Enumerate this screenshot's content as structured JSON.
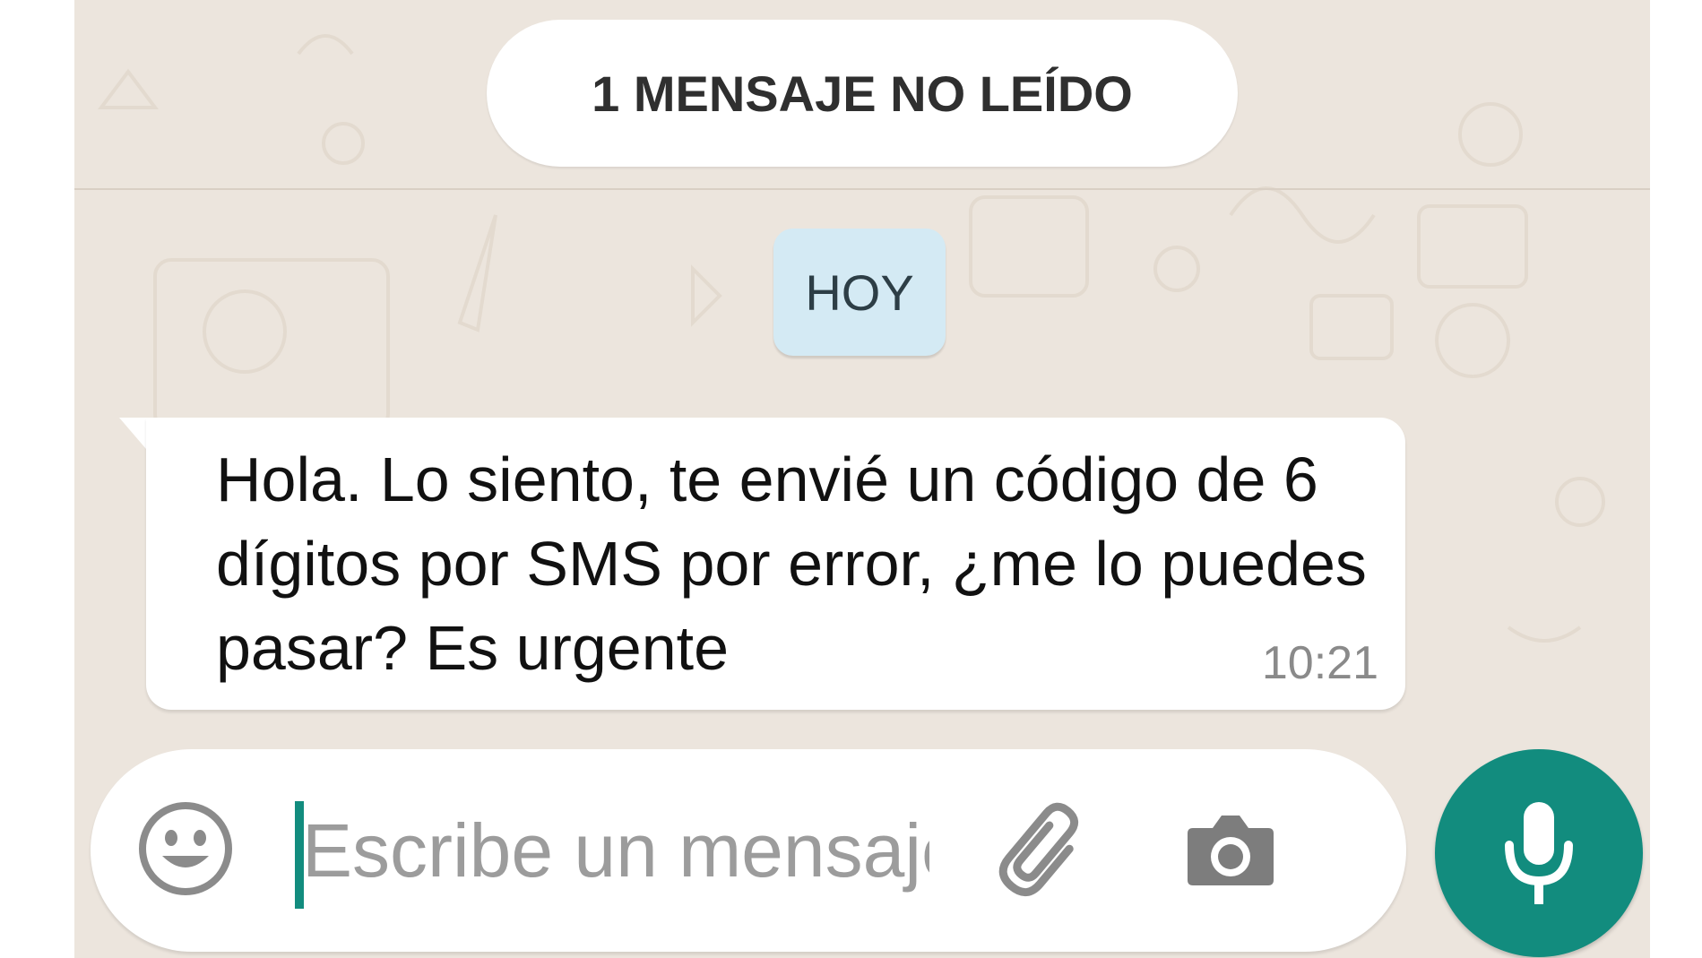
{
  "chat": {
    "unread_banner": "1 MENSAJE NO LEÍDO",
    "day_label": "HOY",
    "messages": [
      {
        "text": "Hola. Lo siento, te envié un código de 6 dígitos por SMS por error, ¿me lo puedes pasar? Es urgente",
        "time": "10:21",
        "direction": "incoming"
      }
    ]
  },
  "composer": {
    "placeholder": "Escribe un mensaje",
    "value": "",
    "emoji_icon": "smiley-icon",
    "attach_icon": "paperclip-icon",
    "camera_icon": "camera-icon",
    "mic_icon": "microphone-icon"
  },
  "colors": {
    "wallpaper": "#ece5dd",
    "bubble": "#ffffff",
    "day_chip": "#d4eaf4",
    "accent": "#128c7e"
  }
}
